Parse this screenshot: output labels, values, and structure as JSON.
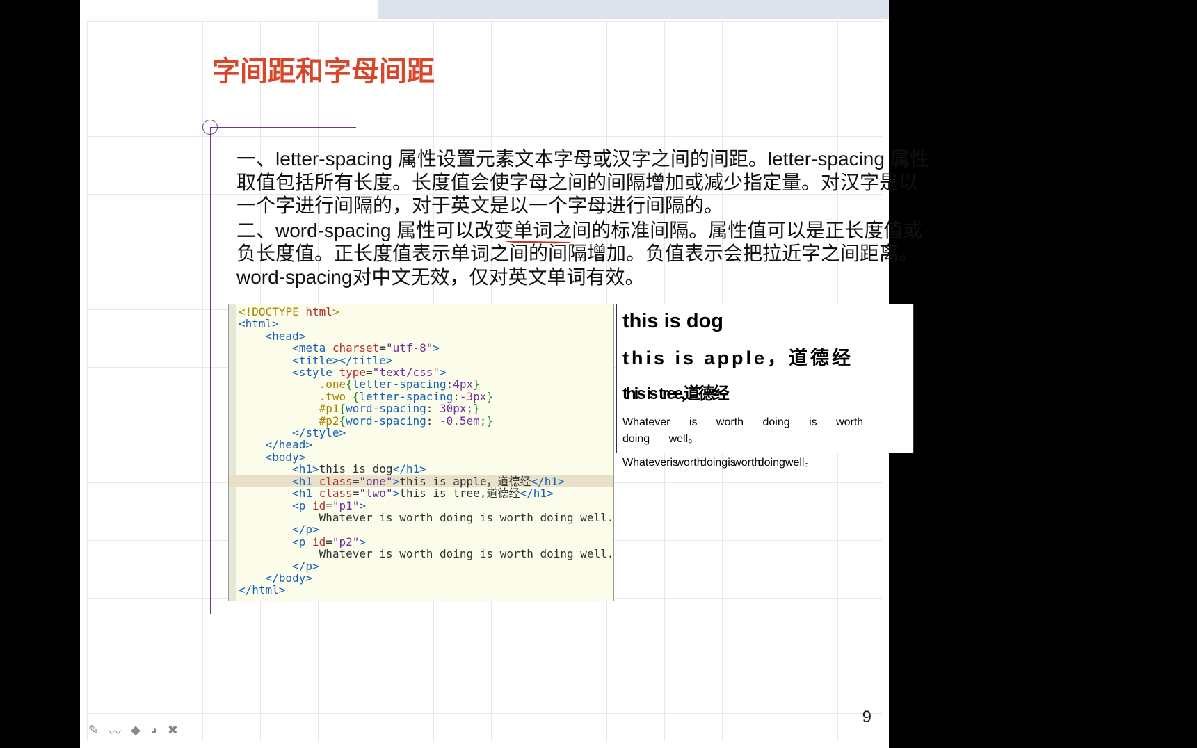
{
  "title": "字间距和字母间距",
  "paragraph1": "一、letter-spacing 属性设置元素文本字母或汉字之间的间距。letter-spacing 属性取值包括所有长度。长度值会使字母之间的间隔增加或减少指定量。对汉字是以一个字进行间隔的，对于英文是以一个字母进行间隔的。",
  "paragraph2": "二、word-spacing 属性可以改变单词之间的标准间隔。属性值可以是正长度值或负长度值。正长度值表示单词之间的间隔增加。负值表示会把拉近字之间距离。word-spacing对中文无效，仅对英文单词有效。",
  "code": {
    "l1a": "<!DOCTYPE ",
    "l1b": "html",
    "l1c": ">",
    "l2a": "<html>",
    "l3a": "<head>",
    "l4a": "<meta ",
    "l4b": "charset",
    "l4c": "=",
    "l4d": "\"utf-8\"",
    "l4e": ">",
    "l5a": "<title></title>",
    "l6a": "<style ",
    "l6b": "type",
    "l6c": "=",
    "l6d": "\"text/css\"",
    "l6e": ">",
    "l7a": ".one",
    "l7b": "{",
    "l7c": "letter-spacing",
    "l7d": ":",
    "l7e": "4px",
    "l7f": "}",
    "l8a": ".two ",
    "l8b": "{",
    "l8c": "letter-spacing",
    "l8d": ":",
    "l8e": "-3px",
    "l8f": "}",
    "l9a": "#p1",
    "l9b": "{",
    "l9c": "word-spacing",
    "l9d": ": ",
    "l9e": "30px",
    "l9f": ";}",
    "l10a": "#p2",
    "l10b": "{",
    "l10c": "word-spacing",
    "l10d": ": ",
    "l10e": "-0.5em",
    "l10f": ";}",
    "l11a": "</style>",
    "l12a": "</head>",
    "l13a": "<body>",
    "l14a": "<h1>",
    "l14b": "this is dog",
    "l14c": "</h1>",
    "l15a": "<h1 ",
    "l15b": "class",
    "l15c": "=",
    "l15d": "\"one\"",
    "l15e": ">",
    "l15f": "this is apple，道德经",
    "l15g": "</h1>",
    "l16a": "<h1 ",
    "l16b": "class",
    "l16c": "=",
    "l16d": "\"two\"",
    "l16e": ">",
    "l16f": "this is tree,道德经",
    "l16g": "</h1>",
    "l17a": "<p ",
    "l17b": "id",
    "l17c": "=",
    "l17d": "\"p1\"",
    "l17e": ">",
    "l18a": "Whatever is worth doing is worth doing well.",
    "l19a": "</p>",
    "l20a": "<p ",
    "l20b": "id",
    "l20c": "=",
    "l20d": "\"p2\"",
    "l20e": ">",
    "l21a": "Whatever is worth doing is worth doing well.",
    "l22a": "</p>",
    "l23a": "</body>",
    "l24a": "</html>"
  },
  "render": {
    "h1": "this is dog",
    "h2": "this is apple，道德经",
    "h3": "this is tree,道德经",
    "p1": "Whatever is worth doing is worth doing well。",
    "p2": "Whateveris worth doingis worth doingwell。"
  },
  "pagenum": "9",
  "tools": {
    "t1": "✎",
    "t2": "〰",
    "t3": "◆",
    "t4": "◕",
    "t5": "✖"
  }
}
